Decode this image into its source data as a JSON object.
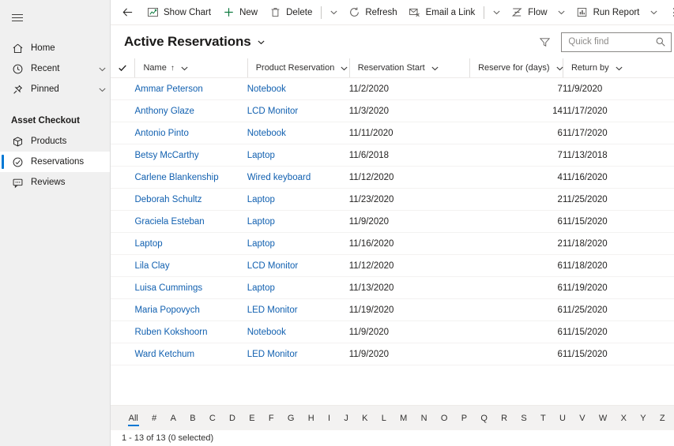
{
  "sidebar": {
    "hamburger_label": "menu",
    "top_items": [
      {
        "label": "Home",
        "icon": "home-icon",
        "chevron": false
      },
      {
        "label": "Recent",
        "icon": "clock-icon",
        "chevron": true
      },
      {
        "label": "Pinned",
        "icon": "pin-icon",
        "chevron": true
      }
    ],
    "group_title": "Asset Checkout",
    "group_items": [
      {
        "label": "Products",
        "icon": "box-icon",
        "selected": false
      },
      {
        "label": "Reservations",
        "icon": "check-circle-icon",
        "selected": true
      },
      {
        "label": "Reviews",
        "icon": "comment-icon",
        "selected": false
      }
    ]
  },
  "commandbar": {
    "back_label": "Back",
    "items": [
      {
        "label": "Show Chart",
        "icon": "chart-icon",
        "chevron": false,
        "sep_after": false
      },
      {
        "label": "New",
        "icon": "plus-icon",
        "chevron": false,
        "sep_after": false
      },
      {
        "label": "Delete",
        "icon": "trash-icon",
        "chevron": true,
        "sep_after": true
      },
      {
        "label": "Refresh",
        "icon": "refresh-icon",
        "chevron": false,
        "sep_after": false
      },
      {
        "label": "Email a Link",
        "icon": "email-icon",
        "chevron": true,
        "sep_after": true
      },
      {
        "label": "Flow",
        "icon": "flow-icon",
        "chevron": true,
        "sep_after": false
      },
      {
        "label": "Run Report",
        "icon": "report-icon",
        "chevron": true,
        "sep_after": false
      }
    ],
    "overflow_label": "More commands"
  },
  "view": {
    "title": "Active Reservations",
    "filter_label": "Filter",
    "search": {
      "placeholder": "Quick find",
      "value": "",
      "icon": "search-icon"
    }
  },
  "table": {
    "select_all_label": "Select all",
    "columns": [
      {
        "label": "Name",
        "sorted": true,
        "sort_dir": "↑",
        "align": "left"
      },
      {
        "label": "Product Reservation",
        "sorted": false,
        "sort_dir": "",
        "align": "left"
      },
      {
        "label": "Reservation Start",
        "sorted": false,
        "sort_dir": "",
        "align": "left"
      },
      {
        "label": "Reserve for (days)",
        "sorted": false,
        "sort_dir": "",
        "align": "right"
      },
      {
        "label": "Return by",
        "sorted": false,
        "sort_dir": "",
        "align": "left"
      }
    ],
    "rows": [
      {
        "name": "Ammar Peterson",
        "product": "Notebook",
        "start": "11/2/2020",
        "days": "7",
        "return": "11/9/2020"
      },
      {
        "name": "Anthony Glaze",
        "product": "LCD Monitor",
        "start": "11/3/2020",
        "days": "14",
        "return": "11/17/2020"
      },
      {
        "name": "Antonio Pinto",
        "product": "Notebook",
        "start": "11/11/2020",
        "days": "6",
        "return": "11/17/2020"
      },
      {
        "name": "Betsy McCarthy",
        "product": "Laptop",
        "start": "11/6/2018",
        "days": "7",
        "return": "11/13/2018"
      },
      {
        "name": "Carlene Blankenship",
        "product": "Wired keyboard",
        "start": "11/12/2020",
        "days": "4",
        "return": "11/16/2020"
      },
      {
        "name": "Deborah Schultz",
        "product": "Laptop",
        "start": "11/23/2020",
        "days": "2",
        "return": "11/25/2020"
      },
      {
        "name": "Graciela Esteban",
        "product": "Laptop",
        "start": "11/9/2020",
        "days": "6",
        "return": "11/15/2020"
      },
      {
        "name": "Laptop",
        "product": "Laptop",
        "start": "11/16/2020",
        "days": "2",
        "return": "11/18/2020"
      },
      {
        "name": "Lila Clay",
        "product": "LCD Monitor",
        "start": "11/12/2020",
        "days": "6",
        "return": "11/18/2020"
      },
      {
        "name": "Luisa Cummings",
        "product": "Laptop",
        "start": "11/13/2020",
        "days": "6",
        "return": "11/19/2020"
      },
      {
        "name": "Maria Popovych",
        "product": "LED Monitor",
        "start": "11/19/2020",
        "days": "6",
        "return": "11/25/2020"
      },
      {
        "name": "Ruben Kokshoorn",
        "product": "Notebook",
        "start": "11/9/2020",
        "days": "6",
        "return": "11/15/2020"
      },
      {
        "name": "Ward Ketchum",
        "product": "LED Monitor",
        "start": "11/9/2020",
        "days": "6",
        "return": "11/15/2020"
      }
    ]
  },
  "alphabar": {
    "items": [
      "All",
      "#",
      "A",
      "B",
      "C",
      "D",
      "E",
      "F",
      "G",
      "H",
      "I",
      "J",
      "K",
      "L",
      "M",
      "N",
      "O",
      "P",
      "Q",
      "R",
      "S",
      "T",
      "U",
      "V",
      "W",
      "X",
      "Y",
      "Z"
    ],
    "active": "All"
  },
  "status": {
    "text": "1 - 13 of 13 (0 selected)"
  },
  "colors": {
    "accent": "#0078d4",
    "link": "#1160b0",
    "sidebar_bg": "#f0f0f0",
    "alphabar_bg": "#f3f2f1",
    "text": "#201f1e",
    "new_icon": "#107c41"
  }
}
